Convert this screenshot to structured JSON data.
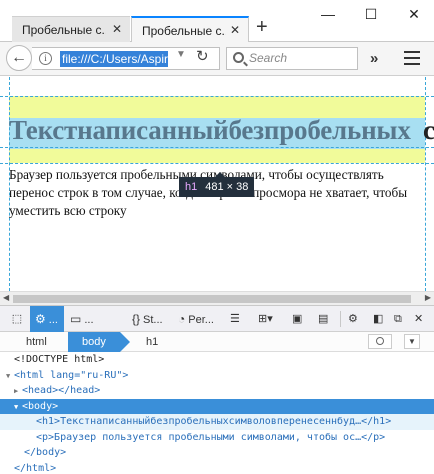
{
  "tabs": [
    {
      "label": "Пробельные с...",
      "active": false
    },
    {
      "label": "Пробельные с...",
      "active": true
    }
  ],
  "window_controls": {
    "minimize": "—",
    "maximize": "☐",
    "close": "✕"
  },
  "nav": {
    "url": "file:///C:/Users/Aspir",
    "search_placeholder": "Search"
  },
  "page": {
    "h1_text": "Текстнаписанныйбезпробельных",
    "h1_overflow_char": "с",
    "paragraph": "Браузер пользуется пробельными символами, чтобы осуществлять перенос строк в том случае, когда ширины просмора не хватает, чтобы уместить всю строку"
  },
  "highlighter_tooltip": {
    "tag": "h1",
    "size": "481 × 38"
  },
  "devtools": {
    "tabs": [
      {
        "icon": "picker-icon",
        "label": ""
      },
      {
        "icon": "inspector-icon",
        "label": "..."
      },
      {
        "icon": "console-icon",
        "label": "..."
      },
      {
        "icon": "debugger-icon",
        "label": "St..."
      },
      {
        "icon": "performance-icon",
        "label": "Per..."
      }
    ],
    "breadcrumbs": [
      "html",
      "body",
      "h1"
    ],
    "selected_crumb": "body"
  },
  "markup": [
    {
      "indent": 0,
      "text": "<!DOCTYPE html>"
    },
    {
      "indent": 0,
      "tw": "▼",
      "text": "<html lang=\"ru-RU\">"
    },
    {
      "indent": 1,
      "tw": "▶",
      "text": "<head></head>"
    },
    {
      "indent": 0,
      "tw": "▼",
      "text": "<body>",
      "selected": true
    },
    {
      "indent": 2,
      "text": "<h1>Текстнаписанныйбезпробельныхсимволовперенесеннбуд…</h1>",
      "highlight": true
    },
    {
      "indent": 2,
      "text": "<p>Браузер пользуется пробельными символами, чтобы ос…</p>"
    },
    {
      "indent": 1,
      "text": "</body>"
    },
    {
      "indent": 0,
      "text": "</html>"
    }
  ]
}
